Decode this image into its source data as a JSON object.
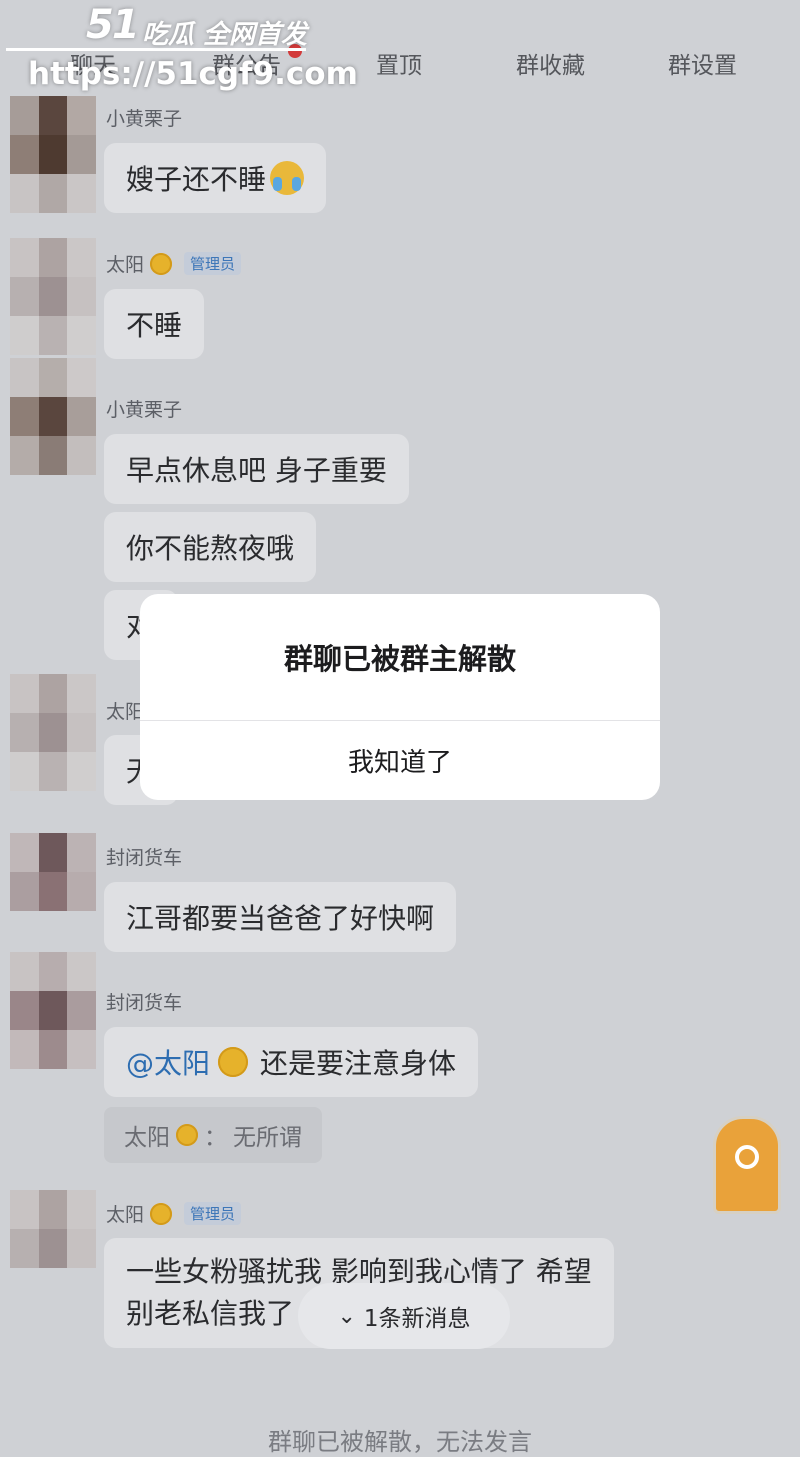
{
  "watermark": {
    "logo": "51",
    "tagline": "吃瓜 全网首发",
    "url": "https://51cgf9.com"
  },
  "tabs": [
    {
      "label": "聊天"
    },
    {
      "label": "群公告"
    },
    {
      "label": "置顶"
    },
    {
      "label": "群收藏"
    },
    {
      "label": "群设置"
    }
  ],
  "messages": [
    {
      "sender": "小黄栗子",
      "text": "嫂子还不睡",
      "emoji": "laughing-crying-icon"
    },
    {
      "sender": "太阳",
      "badge": "管理员",
      "text": "不睡"
    },
    {
      "sender": "小黄栗子",
      "lines": [
        "早点休息吧 身子重要",
        "你不能熬夜哦",
        "对"
      ]
    },
    {
      "sender": "太阳",
      "text": "无"
    },
    {
      "sender": "封闭货车",
      "text": "江哥都要当爸爸了好快啊"
    },
    {
      "sender": "封闭货车",
      "mention": "@太阳",
      "text": "还是要注意身体",
      "quote_sender": "太阳",
      "quote_sep": "：",
      "quote_text": "无所谓"
    },
    {
      "sender": "太阳",
      "badge": "管理员",
      "line1": "一些女粉骚扰我 影响到我心情了 希望",
      "line2": "别老私信我了"
    }
  ],
  "dialog": {
    "title": "群聊已被群主解散",
    "button": "我知道了"
  },
  "new_messages": {
    "label": "1条新消息",
    "icon": "chevron-double-down-icon"
  },
  "footer": {
    "text": "群聊已被解散，无法发言"
  },
  "colors": {
    "background": "#cfd1d5",
    "mention": "#2d6db1",
    "admin_badge": "#3d76b8"
  }
}
